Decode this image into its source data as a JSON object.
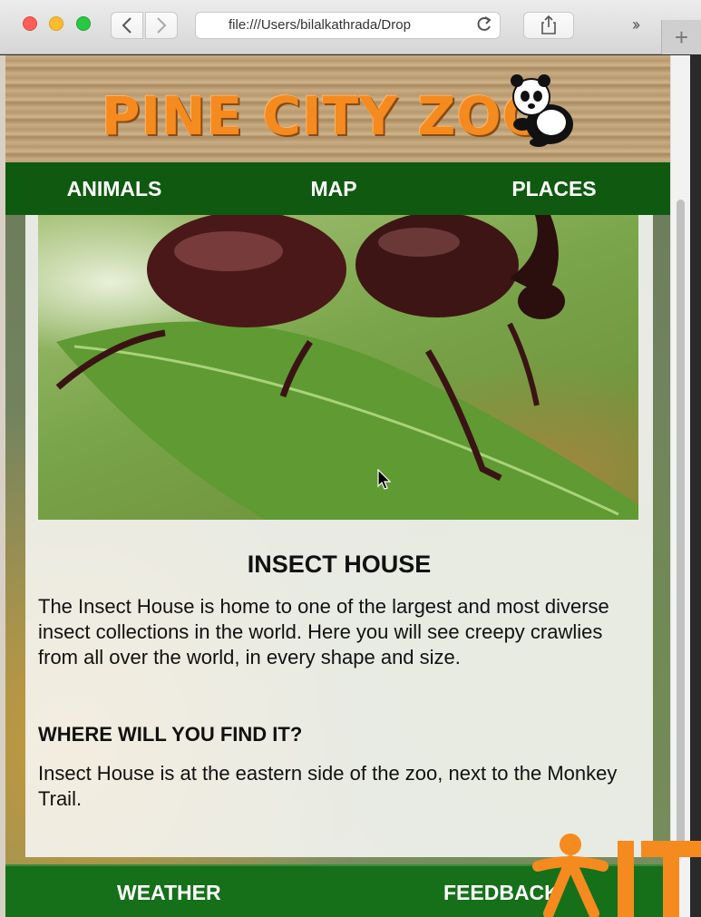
{
  "browser": {
    "url": "file:///Users/bilalkathrada/Drop",
    "more_label": "››",
    "newtab_label": "+"
  },
  "site": {
    "logo_text": "PINE CITY ZOO",
    "accent_color": "#f58a1f",
    "nav_color": "#0f5a10"
  },
  "nav": {
    "items": [
      {
        "label": "ANIMALS"
      },
      {
        "label": "MAP"
      },
      {
        "label": "PLACES"
      }
    ]
  },
  "content": {
    "title": "INSECT HOUSE",
    "body": "The Insect House is home to one of the largest and most diverse insect collections in the world. Here you will see creepy crawlies from all over the world, in every shape and size.",
    "subheading": "WHERE WILL YOU FIND IT?",
    "location": "Insect House is at the eastern side of the zoo, next to the Monkey Trail."
  },
  "footer": {
    "items": [
      {
        "label": "WEATHER"
      },
      {
        "label": "FEEDBACK"
      }
    ]
  },
  "icons": [
    "back-chevron-icon",
    "forward-chevron-icon",
    "reload-icon",
    "share-icon",
    "panda-logo-icon",
    "cursor-icon",
    "watermark-logo"
  ]
}
